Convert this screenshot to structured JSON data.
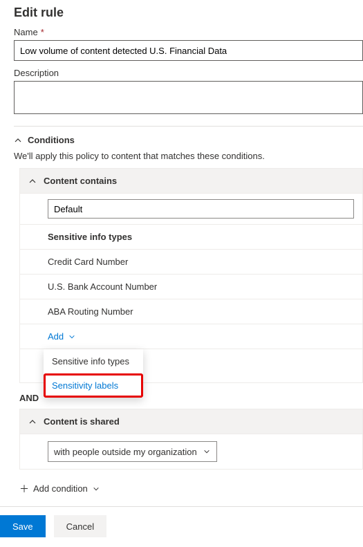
{
  "title": "Edit rule",
  "fields": {
    "name_label": "Name",
    "name_value": "Low volume of content detected U.S. Financial Data",
    "desc_label": "Description",
    "desc_value": ""
  },
  "conditions": {
    "header": "Conditions",
    "help": "We'll apply this policy to content that matches these conditions.",
    "and_label": "AND",
    "content_contains": {
      "title": "Content contains",
      "group_name": "Default",
      "sit_label": "Sensitive info types",
      "items": [
        "Credit Card Number",
        "U.S. Bank Account Number",
        "ABA Routing Number"
      ],
      "add_label": "Add",
      "menu": {
        "sit": "Sensitive info types",
        "labels": "Sensitivity labels"
      }
    },
    "content_shared": {
      "title": "Content is shared",
      "selected": "with people outside my organization"
    },
    "add_condition": "Add condition"
  },
  "footer": {
    "save": "Save",
    "cancel": "Cancel"
  }
}
